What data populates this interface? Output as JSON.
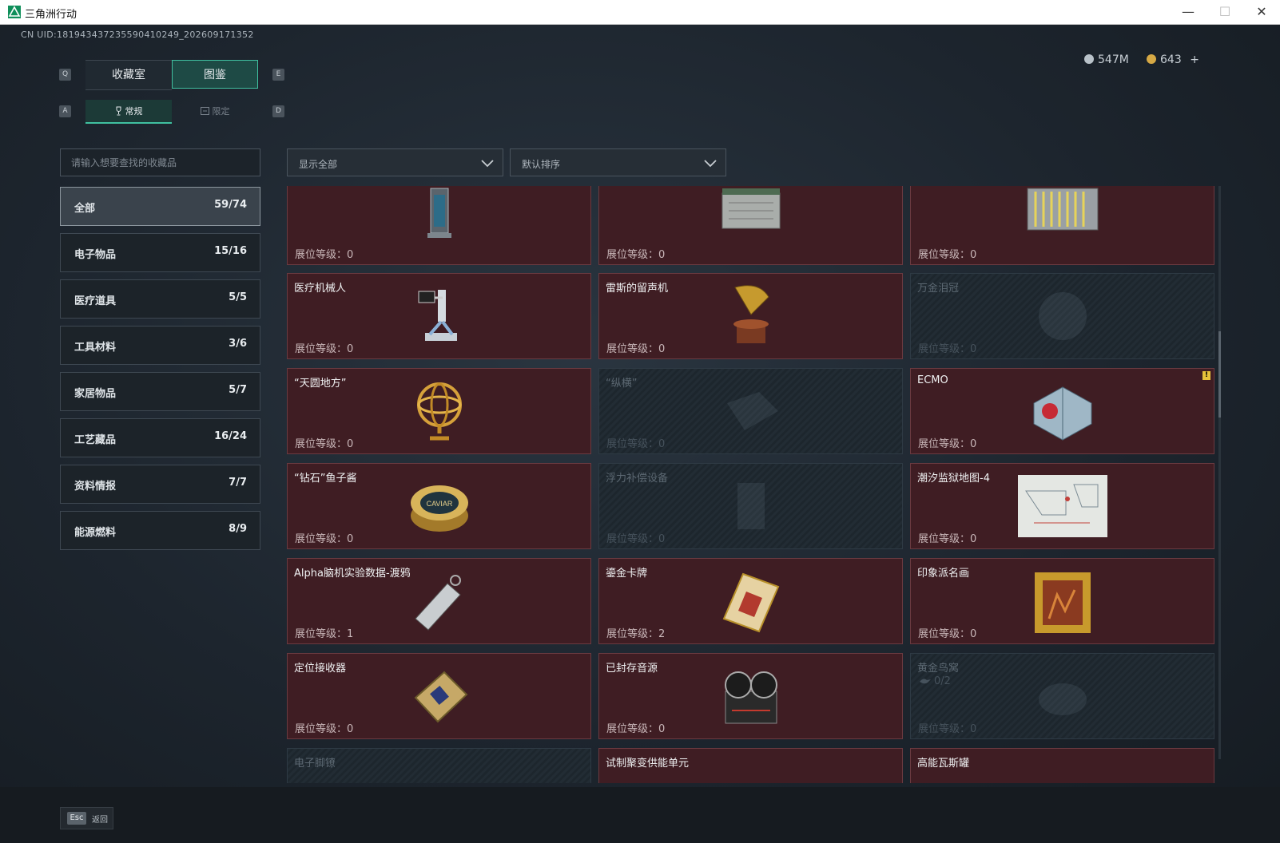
{
  "window": {
    "title": "三角洲行动",
    "minimize": "—",
    "maximize": "☐",
    "close": "✕"
  },
  "uid": "CN UID:181943437235590410249_202609171352",
  "currency": {
    "silver": "547M",
    "gold": "643",
    "add": "+"
  },
  "keys": {
    "q": "Q",
    "e": "E",
    "a": "A",
    "d": "D"
  },
  "tabs": [
    {
      "label": "收藏室"
    },
    {
      "label": "图鉴"
    }
  ],
  "subtabs": [
    {
      "label": "常规"
    },
    {
      "label": "限定"
    }
  ],
  "search": {
    "placeholder": "请输入想要查找的收藏品"
  },
  "categories": [
    {
      "name": "全部",
      "count": "59/74"
    },
    {
      "name": "电子物品",
      "count": "15/16"
    },
    {
      "name": "医疗道具",
      "count": "5/5"
    },
    {
      "name": "工具材料",
      "count": "3/6"
    },
    {
      "name": "家居物品",
      "count": "5/7"
    },
    {
      "name": "工艺藏品",
      "count": "16/24"
    },
    {
      "name": "资料情报",
      "count": "7/7"
    },
    {
      "name": "能源燃料",
      "count": "8/9"
    }
  ],
  "filters": {
    "display": "显示全部",
    "sort": "默认排序"
  },
  "cards": [
    {
      "name": "",
      "level": "展位等级：0",
      "icon": "tesla-coil-icon"
    },
    {
      "name": "",
      "level": "展位等级：0",
      "icon": "server-case-icon"
    },
    {
      "name": "",
      "level": "展位等级：0",
      "icon": "battery-pack-icon"
    },
    {
      "name": "医疗机械人",
      "level": "展位等级：0",
      "icon": "medical-robot-icon"
    },
    {
      "name": "雷斯的留声机",
      "level": "展位等级：0",
      "icon": "gramophone-icon"
    },
    {
      "name": "万金泪冠",
      "level": "展位等级：0",
      "icon": "crown-icon"
    },
    {
      "name": "“天圆地方”",
      "level": "展位等级：0",
      "icon": "armillary-sphere-icon"
    },
    {
      "name": "“纵横”",
      "level": "展位等级：0",
      "icon": "chessboard-icon"
    },
    {
      "name": "ECMO",
      "level": "展位等级：0",
      "icon": "ecmo-machine-icon",
      "warning": "!"
    },
    {
      "name": "“钻石”鱼子酱",
      "level": "展位等级：0",
      "icon": "caviar-tin-icon",
      "tin_label": "CAVIAR"
    },
    {
      "name": "浮力补偿设备",
      "level": "展位等级：0",
      "icon": "buoyancy-device-icon"
    },
    {
      "name": "潮汐监狱地图-4",
      "level": "展位等级：0",
      "icon": "map-sheet-icon"
    },
    {
      "name": "Alpha脑机实验数据-渡鸦",
      "level": "展位等级：1",
      "icon": "usb-drive-icon"
    },
    {
      "name": "鎏金卡牌",
      "level": "展位等级：2",
      "icon": "gilded-card-icon"
    },
    {
      "name": "印象派名画",
      "level": "展位等级：0",
      "icon": "painting-icon"
    },
    {
      "name": "定位接收器",
      "level": "展位等级：0",
      "icon": "receiver-icon"
    },
    {
      "name": "已封存音源",
      "level": "展位等级：0",
      "icon": "tape-recorder-icon"
    },
    {
      "name": "黄金鸟窝",
      "level": "展位等级：0",
      "icon": "bird-nest-icon",
      "progress": "0/2"
    },
    {
      "name": "电子脚镣",
      "level": "",
      "icon": "ankle-monitor-icon"
    },
    {
      "name": "试制聚变供能单元",
      "level": "",
      "icon": "fusion-unit-icon"
    },
    {
      "name": "高能瓦斯罐",
      "level": "",
      "icon": "gas-canister-icon"
    }
  ],
  "footer": {
    "key": "Esc",
    "label": "返回"
  },
  "colors": {
    "accent": "#40c0a0",
    "card_owned": "#3f1d23",
    "card_locked": "#222c34",
    "warning": "#e7c23a"
  }
}
